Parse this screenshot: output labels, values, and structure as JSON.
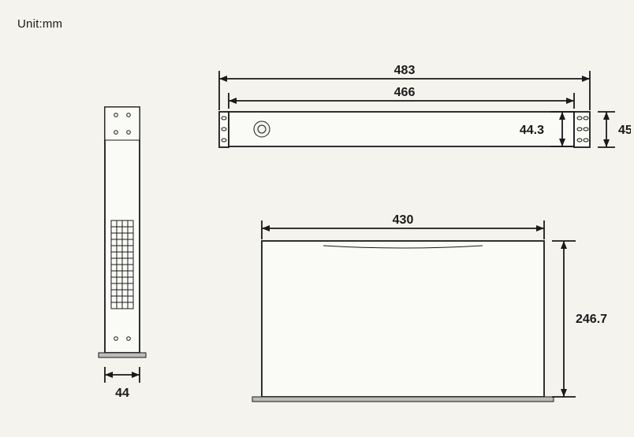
{
  "unit_label": "Unit:mm",
  "dimensions": {
    "overall_width": "483",
    "body_width": "466",
    "front_height": "44.3",
    "ear_height": "45",
    "side_depth": "44",
    "top_width": "430",
    "top_depth": "246.7"
  }
}
